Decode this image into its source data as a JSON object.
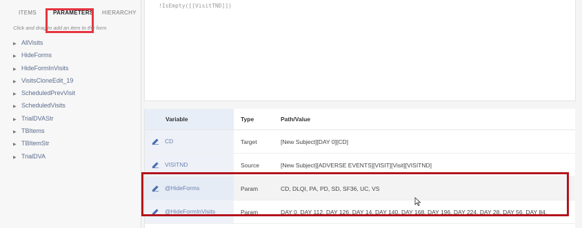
{
  "tabs": {
    "items": "ITEMS",
    "parameters": "PARAMETERS",
    "hierarchy": "HIERARCHY"
  },
  "left_panel": {
    "hint": "Click and drag to add an item to the form",
    "params": [
      "AllVisits",
      "HideForms",
      "HideFormInVisits",
      "VisitsCloneEdit_19",
      "ScheduledPrevVisit",
      "ScheduledVisits",
      "TrialDVAStr",
      "TBItems",
      "TBItemStr",
      "TrialDVA"
    ]
  },
  "editor": {
    "code": "!IsEmpty([[VisitTND]])"
  },
  "table": {
    "headers": [
      "Variable",
      "Type",
      "Path/Value"
    ],
    "rows": [
      {
        "variable": "CD",
        "type": "Target",
        "value": "[New Subject][DAY 0][CD]"
      },
      {
        "variable": "VISITND",
        "type": "Source",
        "value": "[New Subject][ADVERSE EVENTS][VISIT][Visit][VISITND]"
      },
      {
        "variable": "@HideForms",
        "type": "Param",
        "value": "CD, DLQI, PA, PD, SD, SF36, UC, VS"
      },
      {
        "variable": "@HideFormInVisits",
        "type": "Param",
        "value": "DAY 0, DAY 112, DAY 126, DAY 14, DAY 140, DAY 168, DAY 196, DAY 224, DAY 28, DAY 56, DAY 84,"
      }
    ]
  },
  "colors": {
    "tab_highlight": "#e53340",
    "row_highlight": "#b3121b",
    "link": "#5a6b8c"
  }
}
